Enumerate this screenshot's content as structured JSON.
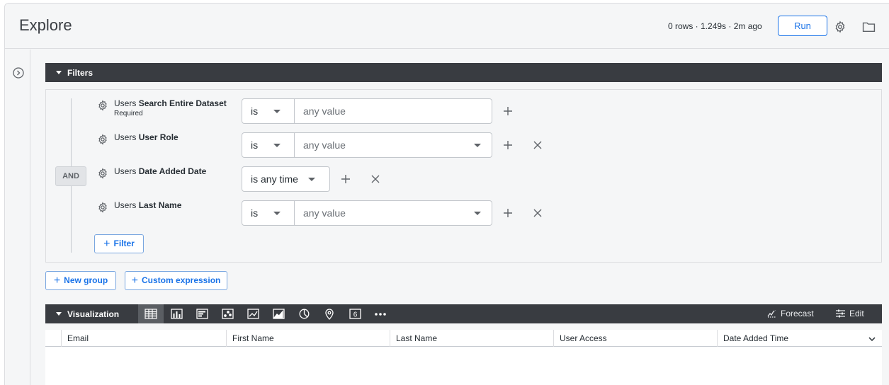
{
  "header": {
    "title": "Explore",
    "meta": "0 rows · 1.249s · 2m ago",
    "run_label": "Run",
    "settings_icon": "gear-icon",
    "folder_icon": "folder-icon"
  },
  "filters": {
    "section_title": "Filters",
    "logic_label": "AND",
    "rows": [
      {
        "view": "Users",
        "field": "Search Entire Dataset",
        "sub": "Required",
        "operator": "is",
        "placeholder": "any value"
      },
      {
        "view": "Users",
        "field": "User Role",
        "operator": "is",
        "placeholder": "any value"
      },
      {
        "view": "Users",
        "field": "Date Added Date",
        "operator": "is any time"
      },
      {
        "view": "Users",
        "field": "Last Name",
        "operator": "is",
        "placeholder": "any value"
      }
    ],
    "add_filter_label": "Filter",
    "new_group_label": "New group",
    "custom_expression_label": "Custom expression"
  },
  "visualization": {
    "section_title": "Visualization",
    "tools": [
      "table-icon",
      "column-chart-icon",
      "bar-chart-icon",
      "scatter-chart-icon",
      "line-chart-icon",
      "area-chart-icon",
      "pie-chart-icon",
      "map-pin-icon",
      "single-value-icon",
      "more-icon"
    ],
    "forecast_label": "Forecast",
    "edit_label": "Edit"
  },
  "table": {
    "columns": [
      "Email",
      "First Name",
      "Last Name",
      "User Access",
      "Date Added Time"
    ]
  },
  "colors": {
    "accent": "#1a73e8",
    "bar_bg": "#393c41",
    "page_bg": "#f5f6f7"
  }
}
